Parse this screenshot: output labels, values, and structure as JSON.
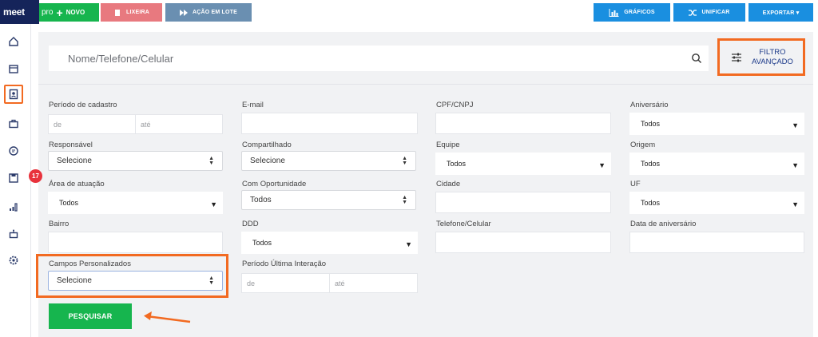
{
  "brand": {
    "logo": "meet",
    "pro": "pro"
  },
  "toolbar": {
    "novo": "NOVO",
    "lixeira": "LIXEIRA",
    "acao_lote": "AÇÃO EM LOTE",
    "graficos": "GRÁFICOS",
    "unificar": "UNIFICAR",
    "exportar": "EXPORTAR ▾"
  },
  "colors": {
    "green": "#16b54e",
    "red_btn": "#e8797f",
    "gray_btn": "#6a8fb1",
    "blue_btn": "#1a8fe0",
    "highlight": "#f26a21",
    "logo_bg": "#15245a"
  },
  "sidebar": {
    "icons": [
      "home-icon",
      "calendar-icon",
      "contacts-icon",
      "briefcase-icon",
      "chat-icon",
      "save-icon",
      "chart-icon",
      "robot-icon",
      "settings-icon"
    ],
    "badge": "17"
  },
  "search": {
    "placeholder": "Nome/Telefone/Celular"
  },
  "filtro": {
    "line1": "FILTRO",
    "line2": "AVANÇADO"
  },
  "form": {
    "periodo_cadastro": {
      "label": "Período de cadastro",
      "de": "de",
      "ate": "até"
    },
    "email": {
      "label": "E-mail"
    },
    "cpf": {
      "label": "CPF/CNPJ"
    },
    "aniversario": {
      "label": "Aniversário",
      "value": "Todos"
    },
    "responsavel": {
      "label": "Responsável",
      "value": "Selecione"
    },
    "compartilhado": {
      "label": "Compartilhado",
      "value": "Selecione"
    },
    "equipe": {
      "label": "Equipe",
      "value": "Todos"
    },
    "origem": {
      "label": "Origem",
      "value": "Todos"
    },
    "area": {
      "label": "Área de atuação",
      "value": "Todos"
    },
    "oportunidade": {
      "label": "Com Oportunidade",
      "value": "Todos"
    },
    "cidade": {
      "label": "Cidade"
    },
    "uf": {
      "label": "UF",
      "value": "Todos"
    },
    "bairro": {
      "label": "Bairro"
    },
    "ddd": {
      "label": "DDD",
      "value": "Todos"
    },
    "telefone": {
      "label": "Telefone/Celular"
    },
    "data_aniversario": {
      "label": "Data de aniversário"
    },
    "campos": {
      "label": "Campos Personalizados",
      "value": "Selecione"
    },
    "periodo_interacao": {
      "label": "Período Última Interação",
      "de": "de",
      "ate": "até"
    }
  },
  "actions": {
    "pesquisar": "PESQUISAR"
  }
}
